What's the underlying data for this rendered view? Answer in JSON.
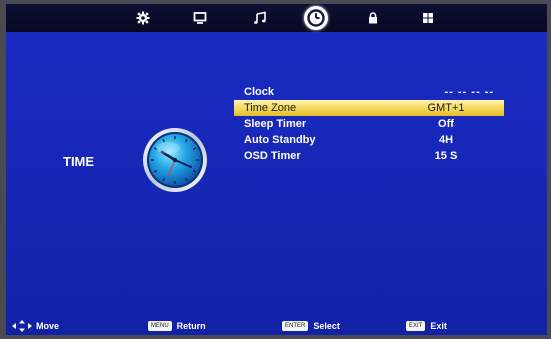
{
  "tabs": [
    {
      "icon": "gear-icon"
    },
    {
      "icon": "monitor-icon"
    },
    {
      "icon": "music-note-icon"
    },
    {
      "icon": "clock-icon",
      "active": true
    },
    {
      "icon": "lock-icon"
    },
    {
      "icon": "grid-icon"
    }
  ],
  "section": {
    "title": "TIME"
  },
  "menu": {
    "clock": {
      "label": "Clock",
      "value": "-- --  -- --"
    },
    "time_zone": {
      "label": "Time Zone",
      "value": "GMT+1"
    },
    "sleep_timer": {
      "label": "Sleep Timer",
      "value": "Off"
    },
    "auto_standby": {
      "label": "Auto Standby",
      "value": "4H"
    },
    "osd_timer": {
      "label": "OSD Timer",
      "value": "15 S"
    }
  },
  "footer": {
    "move": {
      "label": "Move"
    },
    "return": {
      "key": "MENU",
      "label": "Return"
    },
    "select": {
      "key": "ENTER",
      "label": "Select"
    },
    "exit": {
      "key": "EXIT",
      "label": "Exit"
    }
  },
  "colors": {
    "background": "#1626b4",
    "highlight": "#f4d85a",
    "topbar": "#0b0d2e"
  }
}
